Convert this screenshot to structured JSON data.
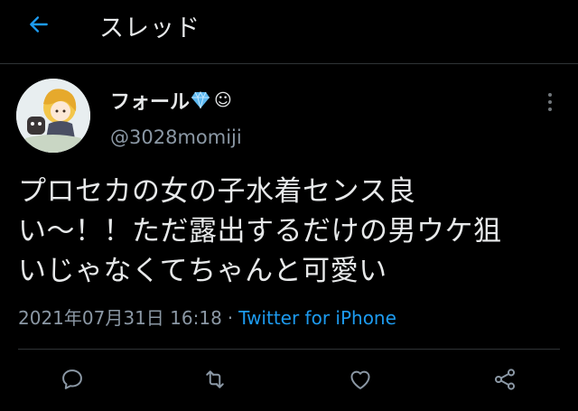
{
  "header": {
    "title": "スレッド",
    "back_icon": "arrow-left-icon",
    "accent": "#1d9bf0"
  },
  "tweet": {
    "author_name": "フォール",
    "author_emoji": "💎",
    "author_emoji2": "☺",
    "handle": "@3028momiji",
    "text": "プロセカの女の子水着センス良\nい〜！！ただ露出するだけの男ウケ狙\nいじゃなくてちゃんと可愛い",
    "timestamp": "2021年07月31日 16:18",
    "separator": "·",
    "source": "Twitter for iPhone"
  },
  "actions": {
    "reply_icon": "reply-icon",
    "retweet_icon": "retweet-icon",
    "like_icon": "heart-icon",
    "share_icon": "share-icon"
  }
}
